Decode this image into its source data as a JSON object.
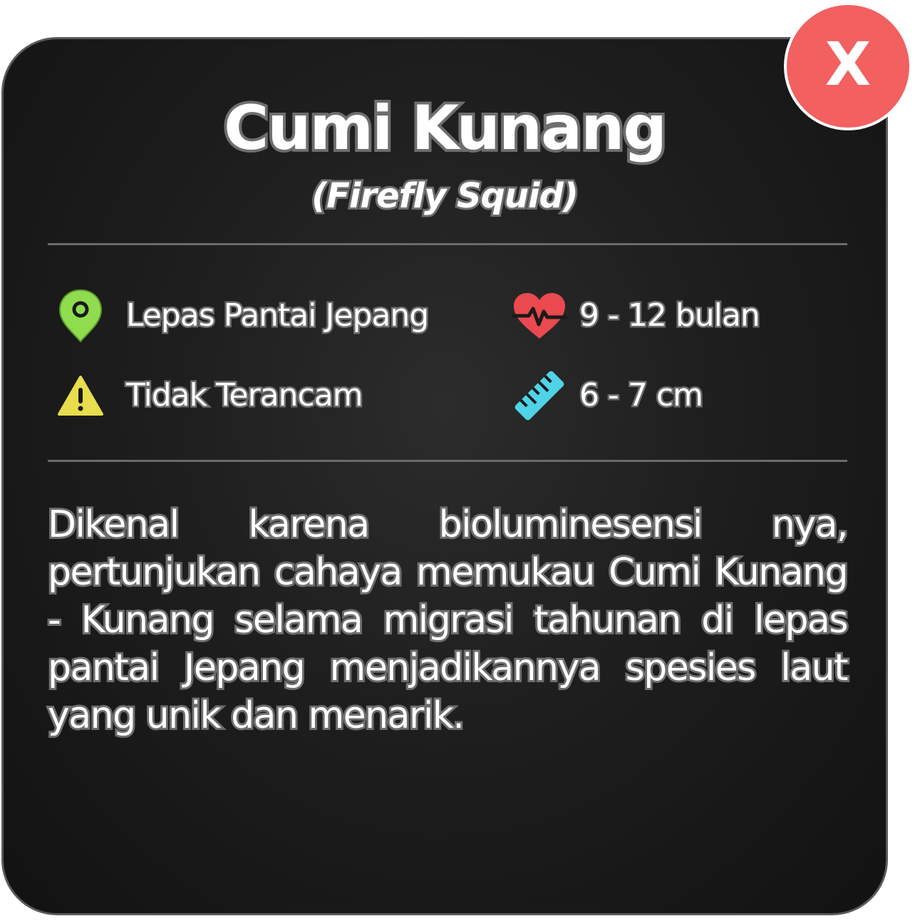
{
  "card": {
    "title": "Cumi Kunang",
    "subtitle": "(Firefly Squid)",
    "stats": [
      {
        "icon": "location-pin-icon",
        "label": "Lepas Pantai Jepang",
        "color": "#8fdc4f"
      },
      {
        "icon": "heart-pulse-icon",
        "label": "9 - 12 bulan",
        "color": "#e9494f"
      },
      {
        "icon": "warning-icon",
        "label": "Tidak Terancam",
        "color": "#e8dd4c"
      },
      {
        "icon": "ruler-icon",
        "label": "6 - 7 cm",
        "color": "#4fd3e6"
      }
    ],
    "description": "Dikenal karena bioluminesensi nya, pertunjukan cahaya memukau Cumi Kunang - Kunang selama migrasi tahunan di lepas pantai Jepang menjadikannya spesies laut yang unik dan menarik."
  },
  "close_button": {
    "label": "X",
    "color": "#f26060"
  }
}
